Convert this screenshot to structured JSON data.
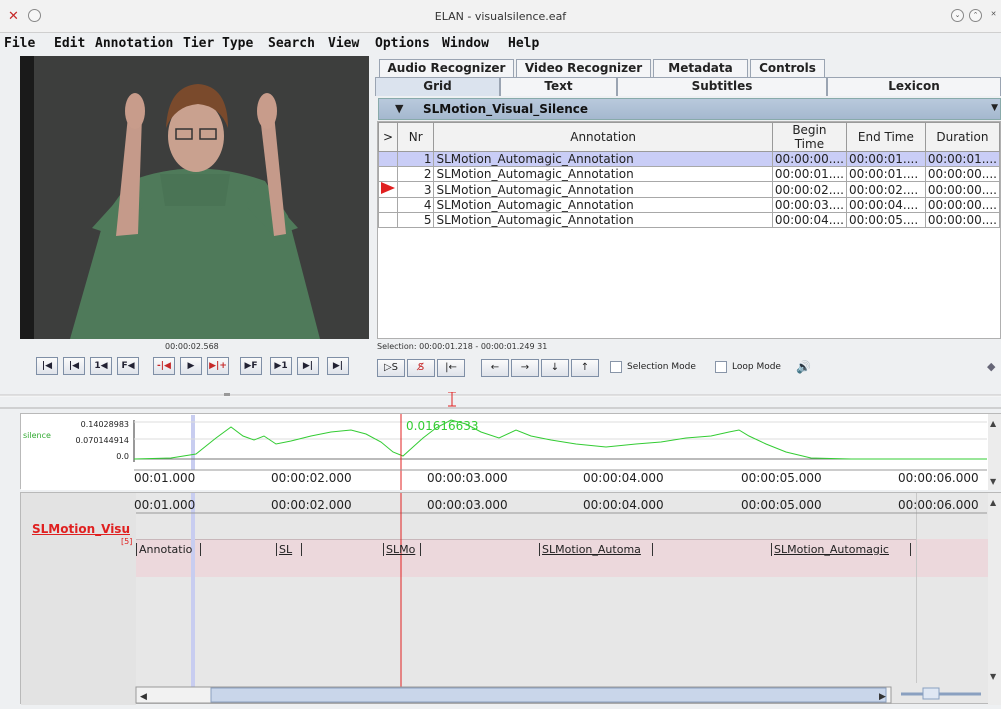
{
  "window": {
    "title": "ELAN - visualsilence.eaf"
  },
  "menu": [
    "File",
    "Edit",
    "Annotation",
    "Tier",
    "Type",
    "Search",
    "View",
    "Options",
    "Window",
    "Help"
  ],
  "video": {
    "time": "00:00:02.568"
  },
  "player_buttons": [
    "|◀",
    "|◀",
    "1◀",
    "F◀",
    "-|◀",
    "▶",
    "▶|+",
    "▶F",
    "▶1",
    "▶|",
    "▶|"
  ],
  "tabs_top": [
    "Audio Recognizer",
    "Video Recognizer",
    "Metadata",
    "Controls"
  ],
  "tabs_bottom": [
    "Grid",
    "Text",
    "Subtitles",
    "Lexicon"
  ],
  "tier": {
    "name": "SLMotion_Visual_Silence"
  },
  "grid": {
    "headers": [
      ">",
      "Nr",
      "Annotation",
      "Begin Time",
      "End Time",
      "Duration"
    ],
    "rows": [
      {
        "nr": "1",
        "annotation": "SLMotion_Automagic_Annotation",
        "begin": "00:00:00....",
        "end": "00:00:01....",
        "duration": "00:00:01...."
      },
      {
        "nr": "2",
        "annotation": "SLMotion_Automagic_Annotation",
        "begin": "00:00:01....",
        "end": "00:00:01....",
        "duration": "00:00:00...."
      },
      {
        "nr": "3",
        "annotation": "SLMotion_Automagic_Annotation",
        "begin": "00:00:02....",
        "end": "00:00:02....",
        "duration": "00:00:00...."
      },
      {
        "nr": "4",
        "annotation": "SLMotion_Automagic_Annotation",
        "begin": "00:00:03....",
        "end": "00:00:04....",
        "duration": "00:00:00...."
      },
      {
        "nr": "5",
        "annotation": "SLMotion_Automagic_Annotation",
        "begin": "00:00:04....",
        "end": "00:00:05....",
        "duration": "00:00:00...."
      }
    ]
  },
  "selection": {
    "text": "Selection: 00:00:01.218 - 00:00:01.249  31"
  },
  "selection_buttons": [
    "▷S",
    "S̸",
    "|←",
    "←",
    "→",
    "↓",
    "↑"
  ],
  "modes": {
    "selection_mode": "Selection Mode",
    "loop_mode": "Loop Mode"
  },
  "waveform": {
    "label": "silence",
    "y_ticks": [
      "0.14028983",
      "0.070144914",
      "0.0"
    ],
    "cursor_value": "0.01616633",
    "time_ticks": [
      "00:01.000",
      "00:00:02.000",
      "00:00:03.000",
      "00:00:04.000",
      "00:00:05.000",
      "00:00:06.000"
    ]
  },
  "timeline": {
    "tier_label": "SLMotion_Visu",
    "tier_count": "[5]",
    "time_ticks": [
      "00:01.000",
      "00:00:02.000",
      "00:00:03.000",
      "00:00:04.000",
      "00:00:05.000",
      "00:00:06.000"
    ],
    "annotations": [
      "Annotatio",
      "SL",
      "SLMo",
      "SLMotion_Automa",
      "SLMotion_Automagic"
    ]
  },
  "colors": {
    "selection_row": "#c9cdf6",
    "accent_red": "#e02020",
    "waveform": "#33cc33",
    "tier_band": "#ecd8dc"
  }
}
